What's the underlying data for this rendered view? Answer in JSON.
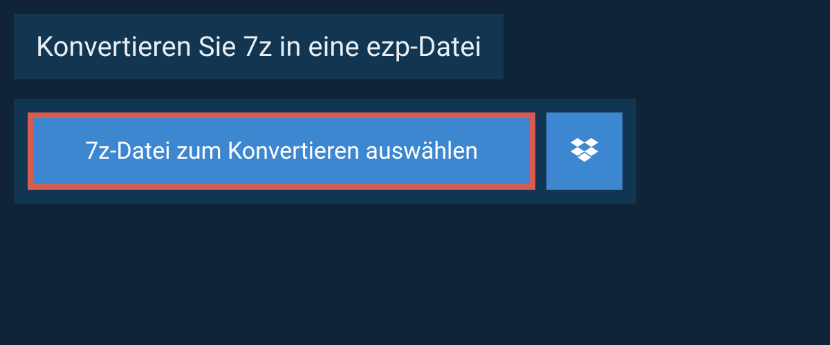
{
  "header": {
    "title": "Konvertieren Sie 7z in eine ezp-Datei"
  },
  "actions": {
    "file_select_label": "7z-Datei zum Konvertieren auswählen",
    "dropbox_icon_name": "dropbox"
  },
  "colors": {
    "page_bg": "#0f2438",
    "panel_bg": "#123652",
    "button_bg": "#3d86d0",
    "highlight_border": "#d95a4f",
    "text_light": "#e8eef3",
    "text_white": "#ffffff"
  }
}
